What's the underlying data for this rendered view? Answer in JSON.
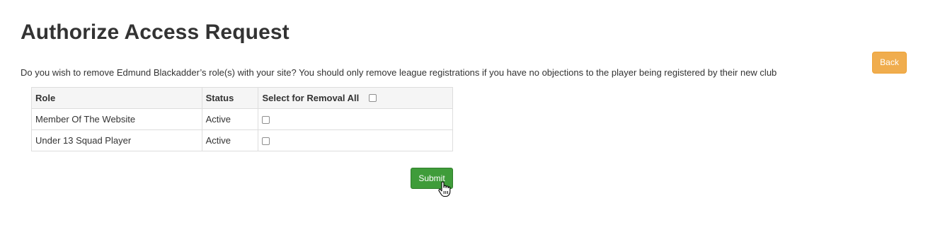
{
  "page": {
    "title": "Authorize Access Request",
    "back_label": "Back",
    "message": "Do you wish to remove Edmund Blackadder’s role(s) with your site? You should only remove league registrations if you have no objections to the player being registered by their new club",
    "submit_label": "Submit"
  },
  "table": {
    "headers": {
      "role": "Role",
      "status": "Status",
      "select": "Select for Removal All"
    },
    "select_all_checked": false,
    "rows": [
      {
        "role": "Member Of The Website",
        "status": "Active",
        "checked": false
      },
      {
        "role": "Under 13 Squad Player",
        "status": "Active",
        "checked": false
      }
    ]
  },
  "colors": {
    "back_button": "#f0ad4e",
    "submit_button": "#3f9c3a",
    "header_background": "#f5f5f5"
  },
  "icons": {
    "cursor": "hand-pointer-icon"
  }
}
